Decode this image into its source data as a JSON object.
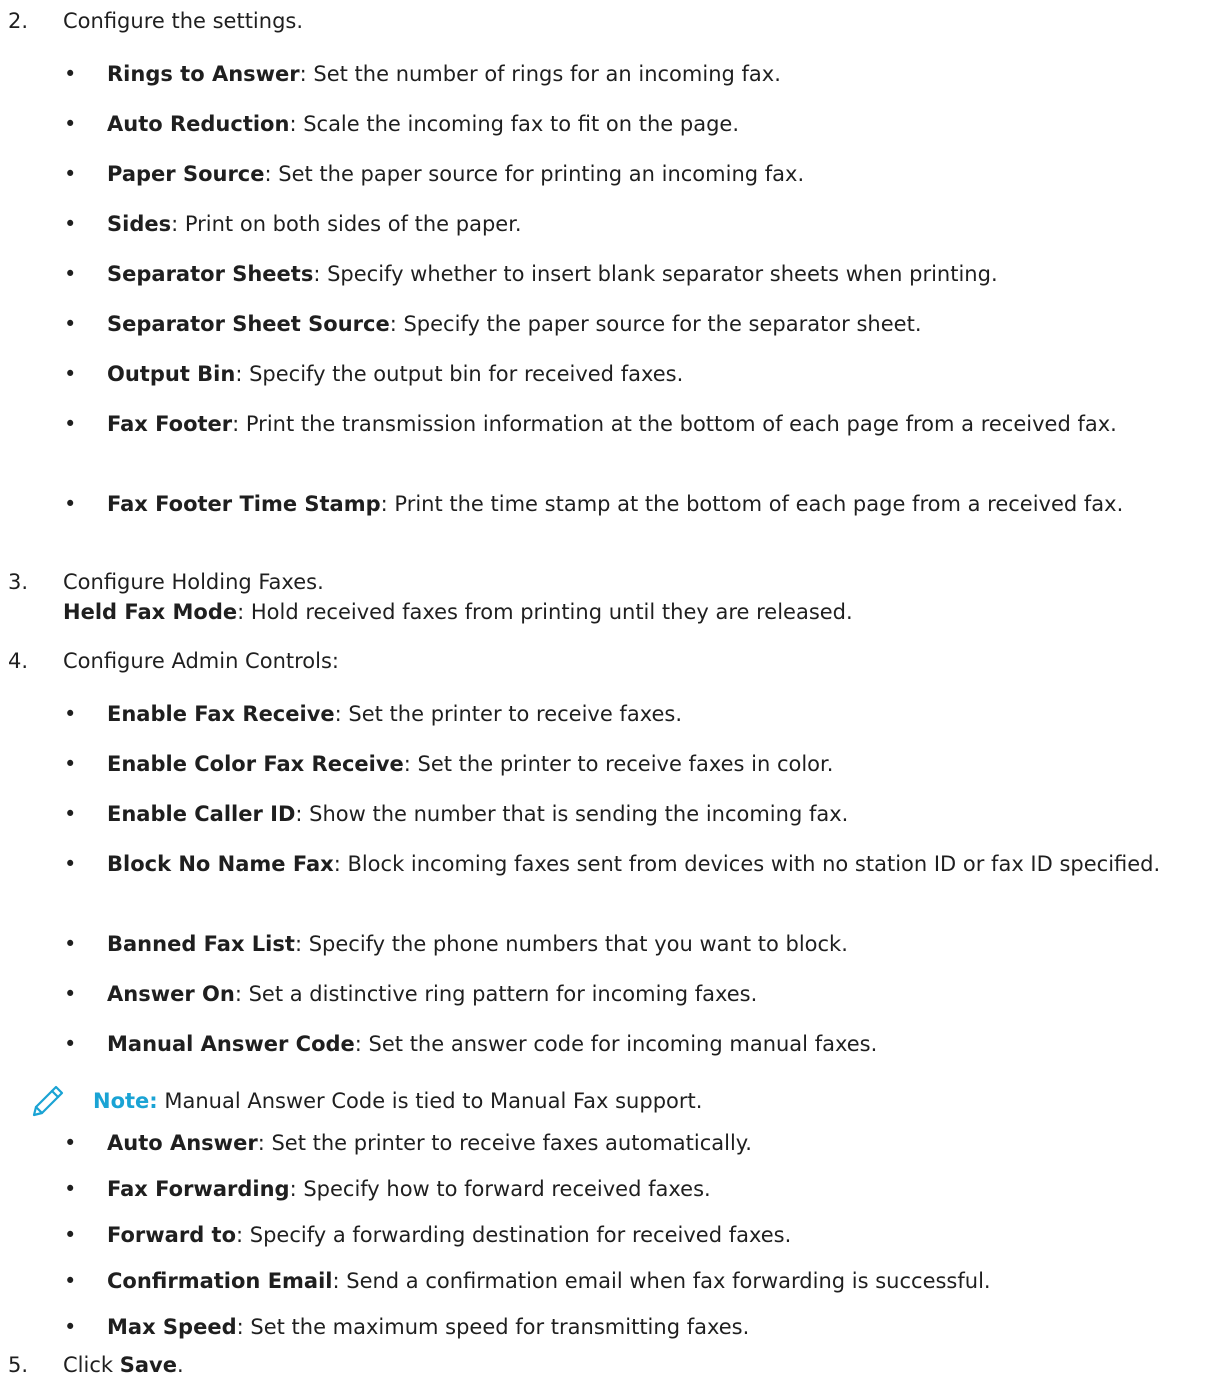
{
  "steps": [
    {
      "num": "2.",
      "text": "Configure the settings."
    },
    {
      "num": "3.",
      "text": "Configure Holding Faxes."
    },
    {
      "num": "4.",
      "text": "Configure Admin Controls:"
    },
    {
      "num": "5.",
      "pre": "Click ",
      "bold": "Save",
      "post": "."
    }
  ],
  "step3_sub": {
    "term": "Held Fax Mode",
    "desc": ": Hold received faxes from printing until they are released."
  },
  "settings_bullets": [
    {
      "term": "Rings to Answer",
      "desc": ": Set the number of rings for an incoming fax."
    },
    {
      "term": "Auto Reduction",
      "desc": ": Scale the incoming fax to fit on the page."
    },
    {
      "term": "Paper Source",
      "desc": ": Set the paper source for printing an incoming fax."
    },
    {
      "term": "Sides",
      "desc": ": Print on both sides of the paper."
    },
    {
      "term": "Separator Sheets",
      "desc": ": Specify whether to insert blank separator sheets when printing."
    },
    {
      "term": "Separator Sheet Source",
      "desc": ": Specify the paper source for the separator sheet."
    },
    {
      "term": "Output Bin",
      "desc": ": Specify the output bin for received faxes."
    },
    {
      "term": "Fax Footer",
      "desc": ": Print the transmission information at the bottom of each page from a received fax."
    },
    {
      "term": "Fax Footer Time Stamp",
      "desc": ": Print the time stamp at the bottom of each page from a received fax."
    }
  ],
  "admin_bullets": [
    {
      "term": "Enable Fax Receive",
      "desc": ": Set the printer to receive faxes."
    },
    {
      "term": "Enable Color Fax Receive",
      "desc": ": Set the printer to receive faxes in color."
    },
    {
      "term": "Enable Caller ID",
      "desc": ": Show the number that is sending the incoming fax."
    },
    {
      "term": "Block No Name Fax",
      "desc": ": Block incoming faxes sent from devices with no station ID or fax ID specified."
    },
    {
      "term": "Banned Fax List",
      "desc": ": Specify the phone numbers that you want to block."
    },
    {
      "term": "Answer On",
      "desc": ": Set a distinctive ring pattern for incoming faxes."
    },
    {
      "term": "Manual Answer Code",
      "desc": ": Set the answer code for incoming manual faxes."
    }
  ],
  "note": {
    "label": "Note:",
    "text": " Manual Answer Code is tied to Manual Fax support.",
    "icon": "pencil-icon",
    "color": "#1aa3d4"
  },
  "admin_bullets_2": [
    {
      "term": "Auto Answer",
      "desc": ": Set the printer to receive faxes automatically."
    },
    {
      "term": "Fax Forwarding",
      "desc": ": Specify how to forward received faxes."
    },
    {
      "term": "Forward to",
      "desc": ": Specify a forwarding destination for received faxes."
    },
    {
      "term": "Confirmation Email",
      "desc": ": Send a confirmation email when fax forwarding is successful."
    },
    {
      "term": "Max Speed",
      "desc": ": Set the maximum speed for transmitting faxes."
    }
  ],
  "bullet_char": "•"
}
